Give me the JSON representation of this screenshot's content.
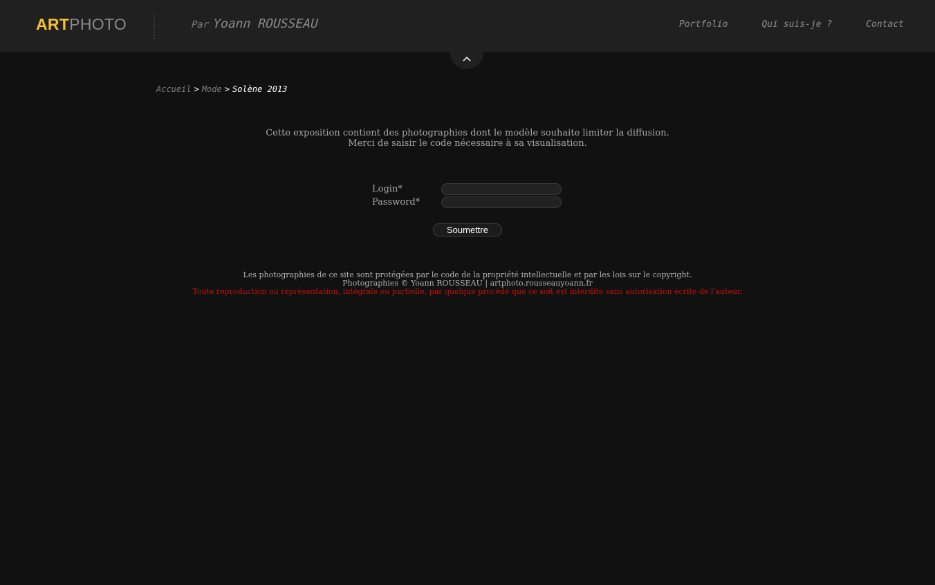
{
  "header": {
    "logo_art": "ART",
    "logo_photo": "PHOTO",
    "tagline_par": "Par",
    "tagline_name": "Yoann ROUSSEAU",
    "nav": [
      {
        "label": "Portfolio"
      },
      {
        "label": "Qui suis-je ?"
      },
      {
        "label": "Contact"
      }
    ],
    "toggle_icon": "chevron-up-icon"
  },
  "breadcrumb": {
    "items": [
      "Accueil",
      "Mode"
    ],
    "separator": ">",
    "current": "Solène 2013"
  },
  "intro": {
    "line1": "Cette exposition contient des photographies dont le modèle souhaite limiter la diffusion.",
    "line2": "Merci de saisir le code nécessaire à sa visualisation."
  },
  "form": {
    "login_label": "Login*",
    "login_value": "",
    "password_label": "Password*",
    "password_value": "",
    "submit_label": "Soumettre"
  },
  "footer": {
    "line1": "Les photographies de ce site sont protégées par le code de la propriété intellectuelle et par les lois sur le copyright.",
    "line2_prefix": "Photographies © Yoann ROUSSEAU | ",
    "line2_link": "artphoto.rousseauyoann.fr",
    "warning": "Toute reproduction ou représentation, intégrale ou partielle, par quelque procédé que ce soit est interdite sans autorisation écrite de l'auteur."
  },
  "colors": {
    "background": "#111111",
    "header_bg": "#202020",
    "logo_accent": "#f4c22b",
    "warning": "#c41010"
  }
}
